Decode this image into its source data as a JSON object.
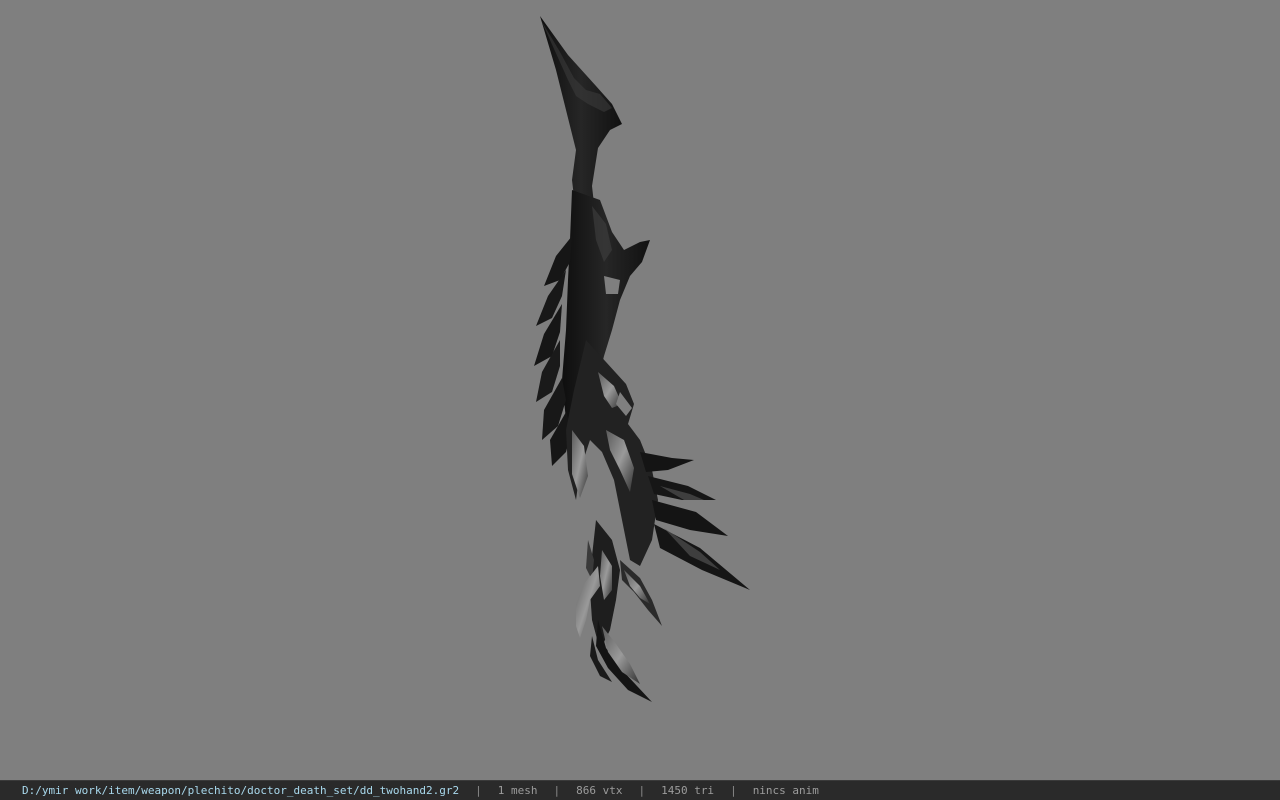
{
  "status_bar": {
    "file_path": "D:/ymir work/item/weapon/plechito/doctor_death_set/dd_twohand2.gr2",
    "separator": "|",
    "mesh_count": "1 mesh",
    "vertex_count": "866 vtx",
    "triangle_count": "1450 tri",
    "anim_status": "nincs anim"
  },
  "viewport": {
    "background_color": "#7f7f7f",
    "model_primary_color": "#1c1c1c",
    "model_highlight_color": "#8a8a8a"
  }
}
